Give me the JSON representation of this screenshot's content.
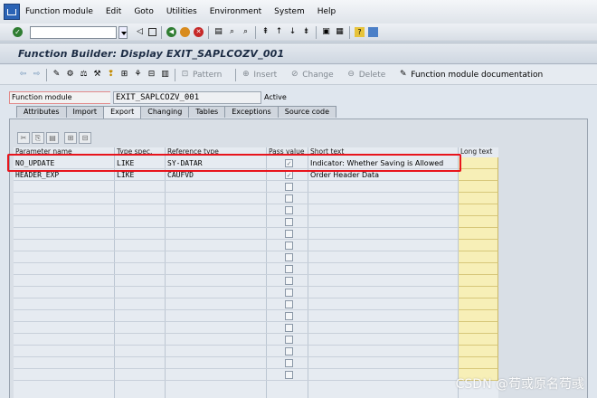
{
  "menu": {
    "items": [
      "Function module",
      "Edit",
      "Goto",
      "Utilities",
      "Environment",
      "System",
      "Help"
    ]
  },
  "system_toolbar": {
    "command_value": ""
  },
  "title": "Function Builder: Display EXIT_SAPLCOZV_001",
  "app_toolbar": {
    "pattern_label": "Pattern",
    "insert_label": "Insert",
    "change_label": "Change",
    "delete_label": "Delete",
    "docu_label": "Function module documentation"
  },
  "header": {
    "label": "Function module",
    "value": "EXIT_SAPLCOZV_001",
    "status": "Active"
  },
  "tabs": [
    "Attributes",
    "Import",
    "Export",
    "Changing",
    "Tables",
    "Exceptions",
    "Source code"
  ],
  "active_tab": "Export",
  "grid": {
    "columns": [
      "Parameter name",
      "Type spec.",
      "Reference type",
      "Pass value",
      "Short text",
      "Long text"
    ],
    "rows": [
      {
        "name": "NO_UPDATE",
        "typespec": "LIKE",
        "reftype": "SY-DATAR",
        "pass_value": true,
        "short_text": "Indicator: Whether Saving is Allowed"
      },
      {
        "name": "HEADER_EXP",
        "typespec": "LIKE",
        "reftype": "CAUFVD",
        "pass_value": true,
        "short_text": "Order Header Data"
      }
    ],
    "empty_rows": 17
  },
  "watermark": "CSDN @苟或原名苟彧",
  "colors": {
    "highlight": "#e8141c",
    "longtext": "#f7efb7",
    "title": "#1c2c44"
  }
}
